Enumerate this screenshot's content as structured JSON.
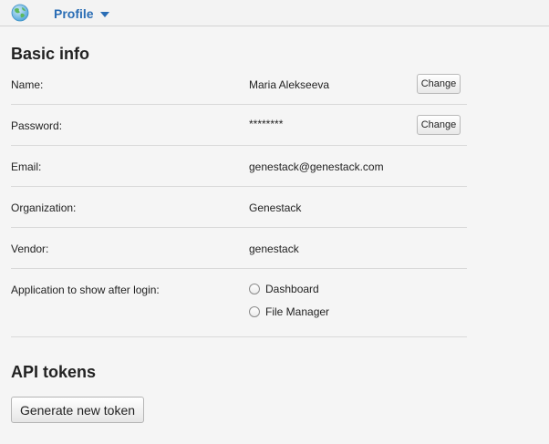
{
  "header": {
    "logo_icon": "globe-logo-icon",
    "profile_menu_label": "Profile",
    "accent_color": "#2a6db5"
  },
  "basic_info": {
    "title": "Basic info",
    "name": {
      "label": "Name:",
      "value": "Maria Alekseeva",
      "button": "Change"
    },
    "password": {
      "label": "Password:",
      "value": "********",
      "button": "Change"
    },
    "email": {
      "label": "Email:",
      "value": "genestack@genestack.com"
    },
    "organization": {
      "label": "Organization:",
      "value": "Genestack"
    },
    "vendor": {
      "label": "Vendor:",
      "value": "genestack"
    },
    "app_after_login": {
      "label": "Application to show after login:",
      "options": [
        "Dashboard",
        "File Manager"
      ]
    }
  },
  "api_tokens": {
    "title": "API tokens",
    "generate_button": "Generate new token"
  }
}
